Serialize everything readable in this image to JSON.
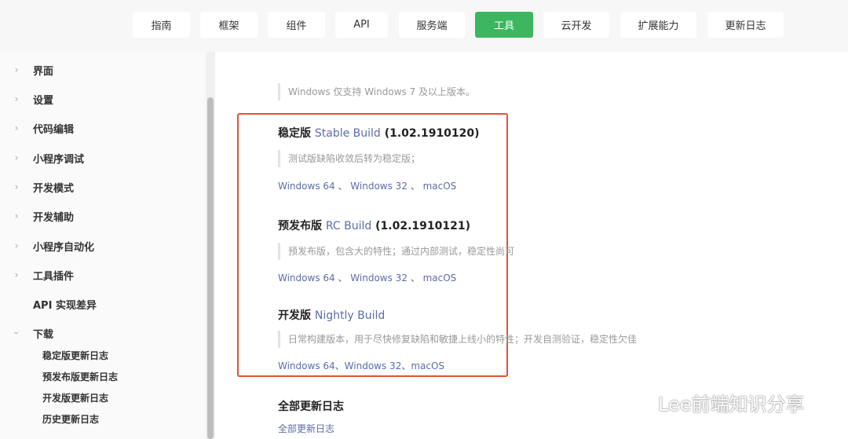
{
  "nav": {
    "items": [
      {
        "label": "指南"
      },
      {
        "label": "框架"
      },
      {
        "label": "组件"
      },
      {
        "label": "API"
      },
      {
        "label": "服务端"
      },
      {
        "label": "工具"
      },
      {
        "label": "云开发"
      },
      {
        "label": "扩展能力"
      },
      {
        "label": "更新日志"
      }
    ],
    "active_color": "#3cb65f"
  },
  "sidebar": {
    "items": [
      {
        "label": "界面"
      },
      {
        "label": "设置"
      },
      {
        "label": "代码编辑"
      },
      {
        "label": "小程序调试"
      },
      {
        "label": "开发模式"
      },
      {
        "label": "开发辅助"
      },
      {
        "label": "小程序自动化"
      },
      {
        "label": "工具插件"
      },
      {
        "label": "API 实现差异"
      },
      {
        "label": "下载"
      }
    ],
    "sub_items": [
      {
        "label": "稳定版更新日志"
      },
      {
        "label": "预发布版更新日志"
      },
      {
        "label": "开发版更新日志"
      },
      {
        "label": "历史更新日志"
      }
    ]
  },
  "content": {
    "windows_note": "Windows 仅支持 Windows 7 及以上版本。",
    "stable": {
      "title": "稳定版",
      "link": "Stable Build",
      "version": "(1.02.1910120)",
      "note": "测试版缺陷收敛后转为稳定版；",
      "win64": "Windows 64",
      "win32": "Windows 32",
      "mac": "macOS",
      "sep": " 、 "
    },
    "rc": {
      "title": "预发布版",
      "link": "RC Build",
      "version": "(1.02.1910121)",
      "note": "预发布版，包含大的特性；通过内部测试，稳定性尚可",
      "win64": "Windows 64",
      "win32": "Windows 32",
      "mac": "macOS",
      "sep": " 、 "
    },
    "nightly": {
      "title": "开发版",
      "link": "Nightly Build",
      "note": "日常构建版本，用于尽快修复缺陷和敏捷上线小的特性；开发自测验证，稳定性欠佳",
      "win64": "Windows 64",
      "win32": "Windows 32",
      "mac": "macOS",
      "sep": "、"
    },
    "all_updates": {
      "title": "全部更新日志",
      "link": "全部更新日志"
    }
  },
  "watermark": {
    "text": "Lee前端知识分享"
  }
}
